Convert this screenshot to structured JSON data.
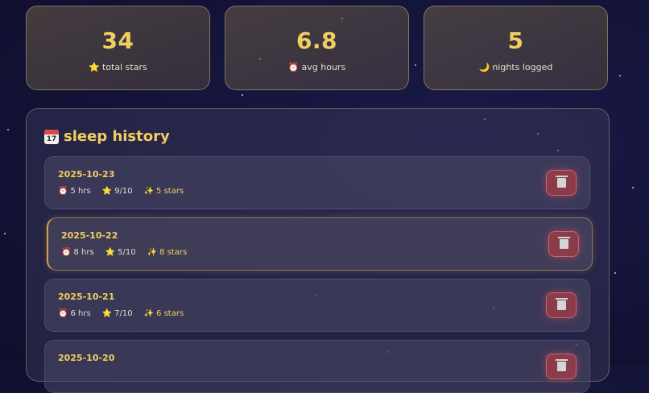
{
  "stats": [
    {
      "value": "34",
      "icon": "star-icon",
      "glyph": "⭐",
      "label": "total stars"
    },
    {
      "value": "6.8",
      "icon": "alarm-clock-icon",
      "glyph": "⏰",
      "label": "avg hours"
    },
    {
      "value": "5",
      "icon": "moon-icon",
      "glyph": "🌙",
      "label": "nights logged"
    }
  ],
  "history": {
    "title": "sleep history",
    "title_icon": "calendar-icon",
    "calendar_day": "17",
    "entries": [
      {
        "date": "2025-10-23",
        "hours": "5 hrs",
        "quality": "9/10",
        "stars": "5 stars",
        "highlighted": false
      },
      {
        "date": "2025-10-22",
        "hours": "8 hrs",
        "quality": "5/10",
        "stars": "8 stars",
        "highlighted": true
      },
      {
        "date": "2025-10-21",
        "hours": "6 hrs",
        "quality": "7/10",
        "stars": "6 stars",
        "highlighted": false
      },
      {
        "date": "2025-10-20",
        "hours": "",
        "quality": "",
        "stars": "",
        "highlighted": false
      }
    ]
  },
  "glyphs": {
    "clock": "⏰",
    "star": "⭐",
    "sparkle": "✨"
  },
  "colors": {
    "accent": "#f1cf5e",
    "delete": "#8a3c4a",
    "background": "#15143a"
  }
}
